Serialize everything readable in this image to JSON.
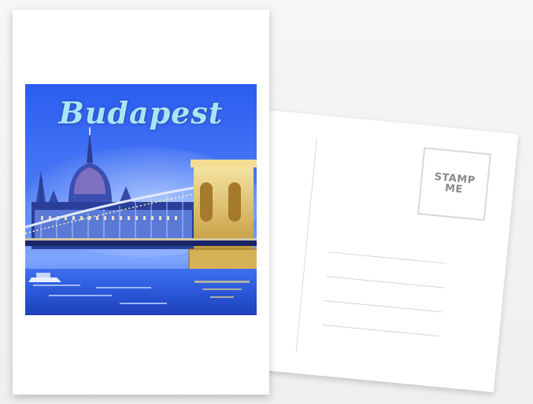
{
  "front_card": {
    "title": "Budapest",
    "palette": {
      "sky": "#2b5df0",
      "sky_light": "#7fa6ff",
      "water": "#2a58d8",
      "bridge_gold": "#e8c76a",
      "lights": "#ffe9a3"
    }
  },
  "back_card": {
    "stamp_line1": "STAMP",
    "stamp_line2": "ME",
    "address_line_count": 4
  }
}
